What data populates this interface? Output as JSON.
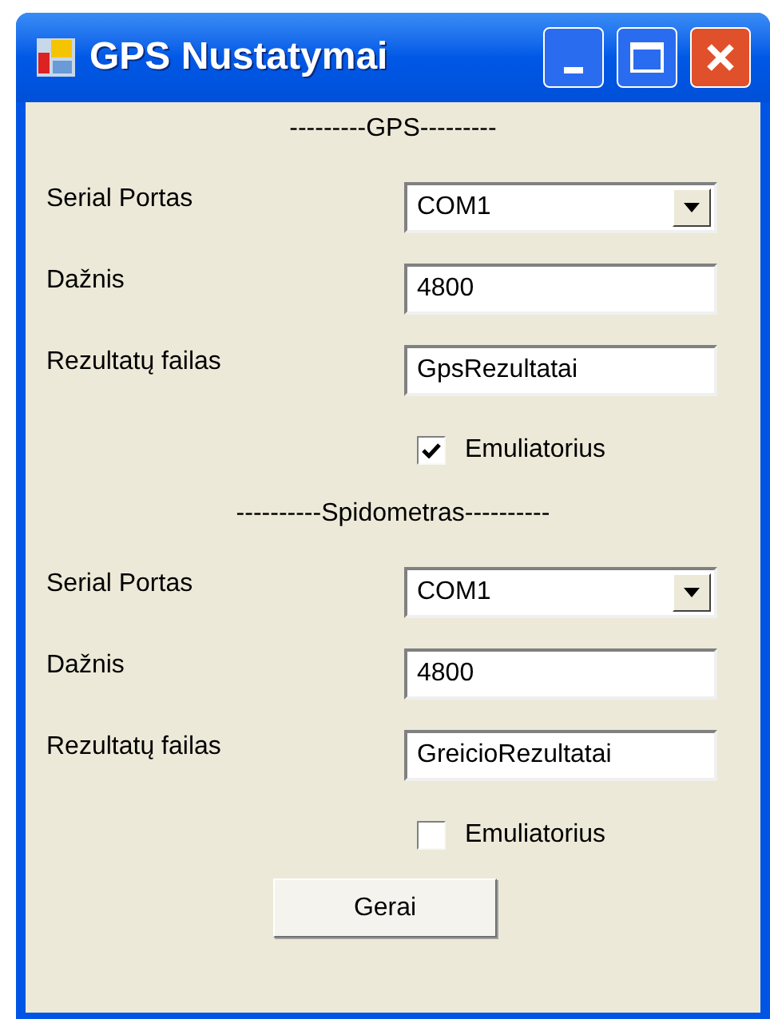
{
  "window": {
    "title": "GPS Nustatymai"
  },
  "sections": [
    {
      "header": "---------GPS---------",
      "fields": [
        {
          "kind": "combo",
          "label": "Serial Portas",
          "value": "COM1"
        },
        {
          "kind": "text",
          "label": "Dažnis",
          "value": "4800"
        },
        {
          "kind": "text",
          "label": "Rezultatų failas",
          "value": "GpsRezultatai"
        }
      ],
      "checkbox": {
        "label": "Emuliatorius",
        "checked": true
      }
    },
    {
      "header": "----------Spidometras----------",
      "fields": [
        {
          "kind": "combo",
          "label": "Serial Portas",
          "value": "COM1"
        },
        {
          "kind": "text",
          "label": "Dažnis",
          "value": "4800"
        },
        {
          "kind": "text",
          "label": "Rezultatų failas",
          "value": "GreicioRezultatai"
        }
      ],
      "checkbox": {
        "label": "Emuliatorius",
        "checked": false
      }
    }
  ],
  "button": "Gerai"
}
